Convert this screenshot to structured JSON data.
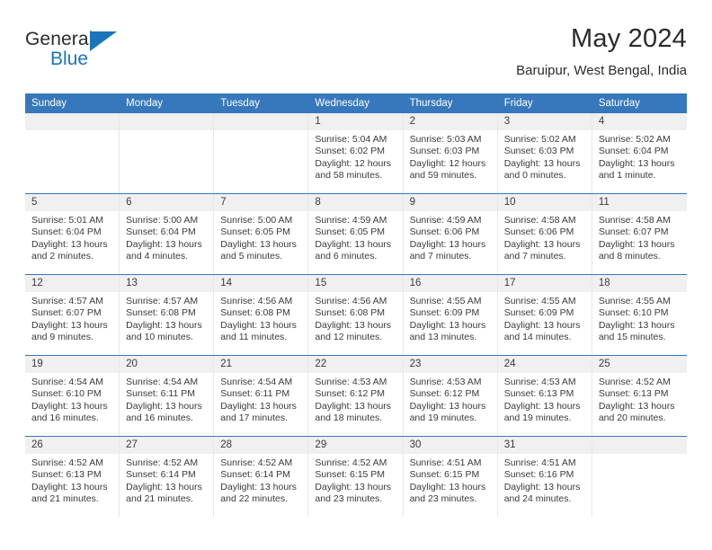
{
  "brand": {
    "name_top": "General",
    "name_bottom": "Blue",
    "accent_color": "#1b75bb"
  },
  "header": {
    "month_title": "May 2024",
    "location": "Baruipur, West Bengal, India"
  },
  "theme": {
    "header_bar_color": "#3678bb",
    "day_band_color": "#f0f0f0",
    "text_color": "#3a3a3a"
  },
  "calendar": {
    "weekdays": [
      "Sunday",
      "Monday",
      "Tuesday",
      "Wednesday",
      "Thursday",
      "Friday",
      "Saturday"
    ],
    "weeks": [
      [
        {
          "day": "",
          "empty": true
        },
        {
          "day": "",
          "empty": true
        },
        {
          "day": "",
          "empty": true
        },
        {
          "day": "1",
          "sunrise": "Sunrise: 5:04 AM",
          "sunset": "Sunset: 6:02 PM",
          "daylight": "Daylight: 12 hours and 58 minutes."
        },
        {
          "day": "2",
          "sunrise": "Sunrise: 5:03 AM",
          "sunset": "Sunset: 6:03 PM",
          "daylight": "Daylight: 12 hours and 59 minutes."
        },
        {
          "day": "3",
          "sunrise": "Sunrise: 5:02 AM",
          "sunset": "Sunset: 6:03 PM",
          "daylight": "Daylight: 13 hours and 0 minutes."
        },
        {
          "day": "4",
          "sunrise": "Sunrise: 5:02 AM",
          "sunset": "Sunset: 6:04 PM",
          "daylight": "Daylight: 13 hours and 1 minute."
        }
      ],
      [
        {
          "day": "5",
          "sunrise": "Sunrise: 5:01 AM",
          "sunset": "Sunset: 6:04 PM",
          "daylight": "Daylight: 13 hours and 2 minutes."
        },
        {
          "day": "6",
          "sunrise": "Sunrise: 5:00 AM",
          "sunset": "Sunset: 6:04 PM",
          "daylight": "Daylight: 13 hours and 4 minutes."
        },
        {
          "day": "7",
          "sunrise": "Sunrise: 5:00 AM",
          "sunset": "Sunset: 6:05 PM",
          "daylight": "Daylight: 13 hours and 5 minutes."
        },
        {
          "day": "8",
          "sunrise": "Sunrise: 4:59 AM",
          "sunset": "Sunset: 6:05 PM",
          "daylight": "Daylight: 13 hours and 6 minutes."
        },
        {
          "day": "9",
          "sunrise": "Sunrise: 4:59 AM",
          "sunset": "Sunset: 6:06 PM",
          "daylight": "Daylight: 13 hours and 7 minutes."
        },
        {
          "day": "10",
          "sunrise": "Sunrise: 4:58 AM",
          "sunset": "Sunset: 6:06 PM",
          "daylight": "Daylight: 13 hours and 7 minutes."
        },
        {
          "day": "11",
          "sunrise": "Sunrise: 4:58 AM",
          "sunset": "Sunset: 6:07 PM",
          "daylight": "Daylight: 13 hours and 8 minutes."
        }
      ],
      [
        {
          "day": "12",
          "sunrise": "Sunrise: 4:57 AM",
          "sunset": "Sunset: 6:07 PM",
          "daylight": "Daylight: 13 hours and 9 minutes."
        },
        {
          "day": "13",
          "sunrise": "Sunrise: 4:57 AM",
          "sunset": "Sunset: 6:08 PM",
          "daylight": "Daylight: 13 hours and 10 minutes."
        },
        {
          "day": "14",
          "sunrise": "Sunrise: 4:56 AM",
          "sunset": "Sunset: 6:08 PM",
          "daylight": "Daylight: 13 hours and 11 minutes."
        },
        {
          "day": "15",
          "sunrise": "Sunrise: 4:56 AM",
          "sunset": "Sunset: 6:08 PM",
          "daylight": "Daylight: 13 hours and 12 minutes."
        },
        {
          "day": "16",
          "sunrise": "Sunrise: 4:55 AM",
          "sunset": "Sunset: 6:09 PM",
          "daylight": "Daylight: 13 hours and 13 minutes."
        },
        {
          "day": "17",
          "sunrise": "Sunrise: 4:55 AM",
          "sunset": "Sunset: 6:09 PM",
          "daylight": "Daylight: 13 hours and 14 minutes."
        },
        {
          "day": "18",
          "sunrise": "Sunrise: 4:55 AM",
          "sunset": "Sunset: 6:10 PM",
          "daylight": "Daylight: 13 hours and 15 minutes."
        }
      ],
      [
        {
          "day": "19",
          "sunrise": "Sunrise: 4:54 AM",
          "sunset": "Sunset: 6:10 PM",
          "daylight": "Daylight: 13 hours and 16 minutes."
        },
        {
          "day": "20",
          "sunrise": "Sunrise: 4:54 AM",
          "sunset": "Sunset: 6:11 PM",
          "daylight": "Daylight: 13 hours and 16 minutes."
        },
        {
          "day": "21",
          "sunrise": "Sunrise: 4:54 AM",
          "sunset": "Sunset: 6:11 PM",
          "daylight": "Daylight: 13 hours and 17 minutes."
        },
        {
          "day": "22",
          "sunrise": "Sunrise: 4:53 AM",
          "sunset": "Sunset: 6:12 PM",
          "daylight": "Daylight: 13 hours and 18 minutes."
        },
        {
          "day": "23",
          "sunrise": "Sunrise: 4:53 AM",
          "sunset": "Sunset: 6:12 PM",
          "daylight": "Daylight: 13 hours and 19 minutes."
        },
        {
          "day": "24",
          "sunrise": "Sunrise: 4:53 AM",
          "sunset": "Sunset: 6:13 PM",
          "daylight": "Daylight: 13 hours and 19 minutes."
        },
        {
          "day": "25",
          "sunrise": "Sunrise: 4:52 AM",
          "sunset": "Sunset: 6:13 PM",
          "daylight": "Daylight: 13 hours and 20 minutes."
        }
      ],
      [
        {
          "day": "26",
          "sunrise": "Sunrise: 4:52 AM",
          "sunset": "Sunset: 6:13 PM",
          "daylight": "Daylight: 13 hours and 21 minutes."
        },
        {
          "day": "27",
          "sunrise": "Sunrise: 4:52 AM",
          "sunset": "Sunset: 6:14 PM",
          "daylight": "Daylight: 13 hours and 21 minutes."
        },
        {
          "day": "28",
          "sunrise": "Sunrise: 4:52 AM",
          "sunset": "Sunset: 6:14 PM",
          "daylight": "Daylight: 13 hours and 22 minutes."
        },
        {
          "day": "29",
          "sunrise": "Sunrise: 4:52 AM",
          "sunset": "Sunset: 6:15 PM",
          "daylight": "Daylight: 13 hours and 23 minutes."
        },
        {
          "day": "30",
          "sunrise": "Sunrise: 4:51 AM",
          "sunset": "Sunset: 6:15 PM",
          "daylight": "Daylight: 13 hours and 23 minutes."
        },
        {
          "day": "31",
          "sunrise": "Sunrise: 4:51 AM",
          "sunset": "Sunset: 6:16 PM",
          "daylight": "Daylight: 13 hours and 24 minutes."
        },
        {
          "day": "",
          "empty": true
        }
      ]
    ]
  }
}
